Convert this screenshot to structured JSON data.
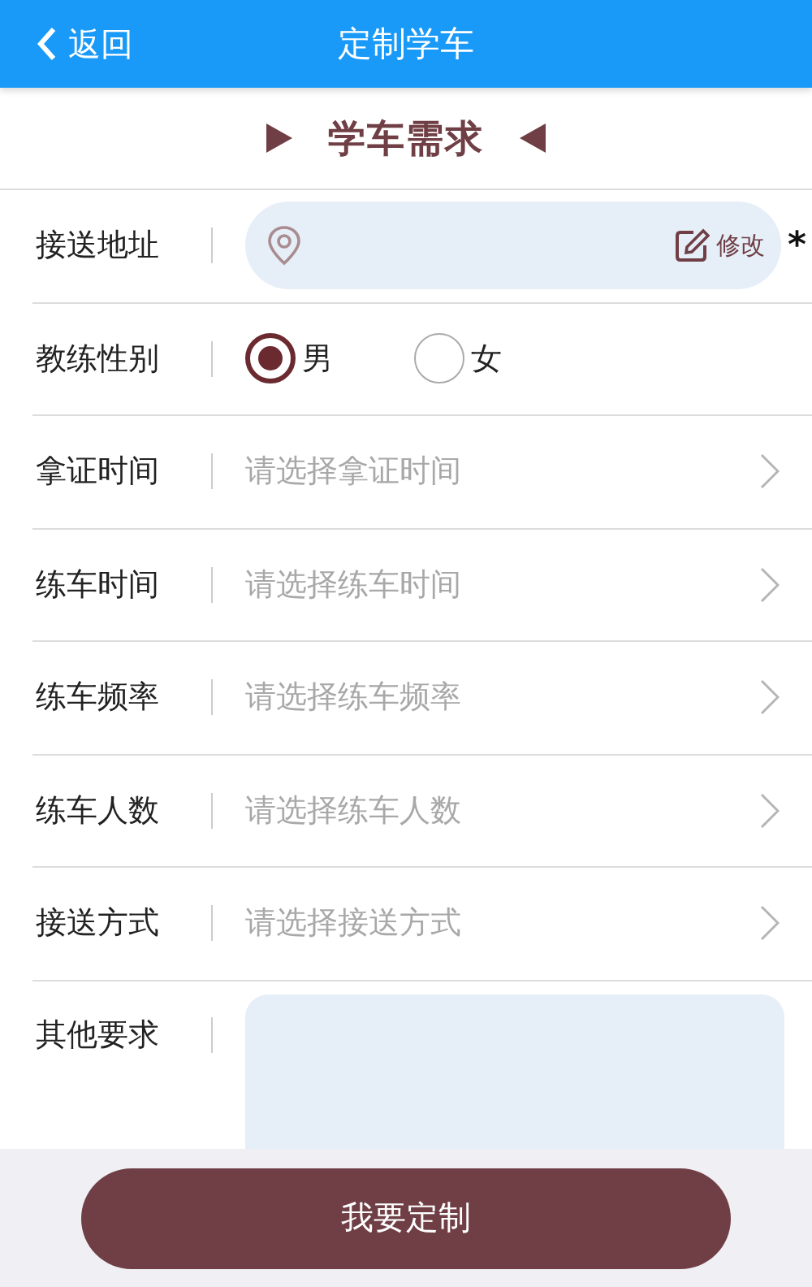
{
  "header": {
    "back_label": "返回",
    "title": "定制学车"
  },
  "section_title": "学车需求",
  "form": {
    "rows": [
      {
        "kind": "address",
        "label": "接送地址",
        "action": "修改",
        "required_mark": "*"
      },
      {
        "kind": "radio",
        "label": "教练性别",
        "options": [
          {
            "label": "男",
            "selected": true
          },
          {
            "label": "女",
            "selected": false
          }
        ]
      },
      {
        "kind": "picker",
        "label": "拿证时间",
        "placeholder": "请选择拿证时间"
      },
      {
        "kind": "picker",
        "label": "练车时间",
        "placeholder": "请选择练车时间"
      },
      {
        "kind": "picker",
        "label": "练车频率",
        "placeholder": "请选择练车频率"
      },
      {
        "kind": "picker",
        "label": "练车人数",
        "placeholder": "请选择练车人数"
      },
      {
        "kind": "picker",
        "label": "接送方式",
        "placeholder": "请选择接送方式"
      },
      {
        "kind": "textarea",
        "label": "其他要求"
      }
    ]
  },
  "submit_button": "我要定制"
}
